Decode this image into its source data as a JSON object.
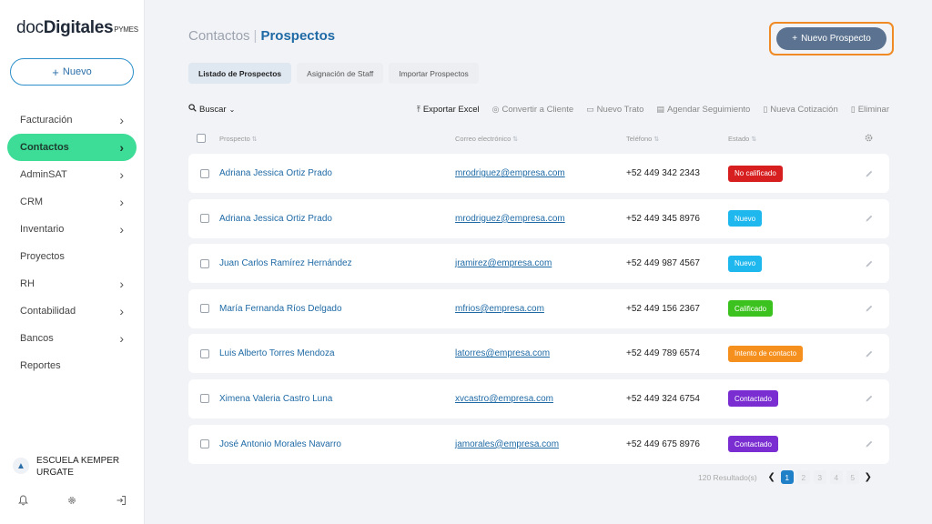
{
  "brand": {
    "part1": "doc",
    "part2": "Digitales",
    "part3": "PYMES"
  },
  "sidebar": {
    "new_label": "Nuevo",
    "items": [
      {
        "label": "Facturación",
        "has_children": true
      },
      {
        "label": "Contactos",
        "has_children": true,
        "active": true
      },
      {
        "label": "AdminSAT",
        "has_children": true
      },
      {
        "label": "CRM",
        "has_children": true
      },
      {
        "label": "Inventario",
        "has_children": true
      },
      {
        "label": "Proyectos",
        "has_children": false
      },
      {
        "label": "RH",
        "has_children": true
      },
      {
        "label": "Contabilidad",
        "has_children": true
      },
      {
        "label": "Bancos",
        "has_children": true
      },
      {
        "label": "Reportes",
        "has_children": false
      }
    ],
    "org_name_line1": "ESCUELA KEMPER",
    "org_name_line2": "URGATE",
    "footer_icons": [
      "bell-icon",
      "gear-icon",
      "logout-icon"
    ]
  },
  "header": {
    "crumb_parent": "Contactos",
    "crumb_sep": "|",
    "crumb_current": "Prospectos",
    "primary_button": "Nuevo Prospecto"
  },
  "tabs": [
    {
      "label": "Listado de Prospectos",
      "active": true
    },
    {
      "label": "Asignación de Staff",
      "active": false
    },
    {
      "label": "Importar Prospectos",
      "active": false
    }
  ],
  "toolbar": {
    "search_label": "Buscar",
    "actions": [
      {
        "label": "Exportar Excel",
        "icon": "upload-icon",
        "enabled": true
      },
      {
        "label": "Convertir a Cliente",
        "icon": "user-convert-icon",
        "enabled": false
      },
      {
        "label": "Nuevo Trato",
        "icon": "briefcase-icon",
        "enabled": false
      },
      {
        "label": "Agendar Seguimiento",
        "icon": "calendar-icon",
        "enabled": false
      },
      {
        "label": "Nueva Cotización",
        "icon": "document-icon",
        "enabled": false
      },
      {
        "label": "Eliminar",
        "icon": "trash-icon",
        "enabled": false
      }
    ]
  },
  "table": {
    "columns": {
      "prospect": "Prospecto",
      "email": "Correo electrónico",
      "phone": "Teléfono",
      "status": "Estado"
    },
    "rows": [
      {
        "name": "Adriana Jessica Ortiz Prado",
        "email": "mrodriguez@empresa.com",
        "phone": "+52 449 342 2343",
        "status": "No calificado",
        "status_color": "#d71f1f"
      },
      {
        "name": "Adriana Jessica Ortiz Prado",
        "email": "mrodriguez@empresa.com",
        "phone": "+52 449 345 8976",
        "status": "Nuevo",
        "status_color": "#1eb7ee"
      },
      {
        "name": "Juan Carlos Ramírez Hernández",
        "email": "jramirez@empresa.com",
        "phone": "+52 449 987 4567",
        "status": "Nuevo",
        "status_color": "#1eb7ee"
      },
      {
        "name": "María Fernanda Ríos Delgado",
        "email": "mfrios@empresa.com",
        "phone": "+52 449 156 2367",
        "status": "Calificado",
        "status_color": "#3cc21f"
      },
      {
        "name": "Luis Alberto Torres Mendoza",
        "email": "latorres@empresa.com",
        "phone": "+52 449 789 6574",
        "status": "Intento de contacto",
        "status_color": "#f5901e"
      },
      {
        "name": "Ximena Valeria Castro Luna",
        "email": "xvcastro@empresa.com",
        "phone": "+52 449 324 6754",
        "status": "Contactado",
        "status_color": "#7a2ed1"
      },
      {
        "name": "José Antonio Morales Navarro",
        "email": "jamorales@empresa.com",
        "phone": "+52 449 675 8976",
        "status": "Contactado",
        "status_color": "#7a2ed1"
      }
    ]
  },
  "pagination": {
    "results": "120 Resultado(s)",
    "pages": [
      "1",
      "2",
      "3",
      "4",
      "5"
    ],
    "current": "1"
  }
}
